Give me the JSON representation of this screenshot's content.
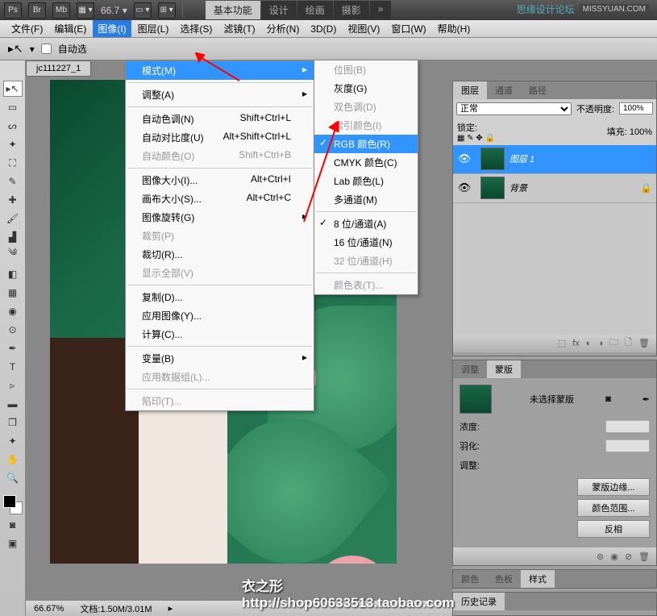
{
  "app": {
    "ps": "Ps",
    "br": "Br",
    "mb": "Mb",
    "zoom_pct": "66.7",
    "logo": "思缘设计论坛",
    "logo2": "MISSYUAN.COM"
  },
  "workspaces": {
    "basic": "基本功能",
    "design": "设计",
    "paint": "绘画",
    "photo": "摄影"
  },
  "menus": {
    "file": "文件(F)",
    "edit": "编辑(E)",
    "image": "图像(I)",
    "layer": "图层(L)",
    "select": "选择(S)",
    "filter": "滤镜(T)",
    "analysis": "分析(N)",
    "threed": "3D(D)",
    "view": "视图(V)",
    "window": "窗口(W)",
    "help": "帮助(H)"
  },
  "options": {
    "autosel": "自动选"
  },
  "doc": {
    "tab": "jc111227_1"
  },
  "dropdown": {
    "mode": "模式(M)",
    "adjust": "调整(A)",
    "autotone": "自动色调(N)",
    "autotone_sc": "Shift+Ctrl+L",
    "autocontrast": "自动对比度(U)",
    "autocontrast_sc": "Alt+Shift+Ctrl+L",
    "autocolor": "自动颜色(O)",
    "autocolor_sc": "Shift+Ctrl+B",
    "imagesize": "图像大小(I)...",
    "imagesize_sc": "Alt+Ctrl+I",
    "canvassize": "画布大小(S)...",
    "canvassize_sc": "Alt+Ctrl+C",
    "rotate": "图像旋转(G)",
    "crop": "裁剪(P)",
    "trim": "裁切(R)...",
    "reveal": "显示全部(V)",
    "dup": "复制(D)...",
    "apply": "应用图像(Y)...",
    "calc": "计算(C)...",
    "variables": "变量(B)",
    "datasets": "应用数据组(L)...",
    "trap": "陷印(T)..."
  },
  "submenu": {
    "bitmap": "位图(B)",
    "gray": "灰度(G)",
    "duotone": "双色调(D)",
    "indexed": "索引颜色(I)",
    "rgb": "RGB 颜色(R)",
    "cmyk": "CMYK 颜色(C)",
    "lab": "Lab 颜色(L)",
    "multi": "多通道(M)",
    "bit8": "8 位/通道(A)",
    "bit16": "16 位/通道(N)",
    "bit32": "32 位/通道(H)",
    "colortable": "颜色表(T)..."
  },
  "panels": {
    "layers_tab": "图层",
    "channels_tab": "通道",
    "paths_tab": "路径",
    "blend": "正常",
    "opacity_label": "不透明度:",
    "opacity_val": "100%",
    "lock_label": "锁定:",
    "fill_label": "填充:",
    "fill_val": "100%",
    "layer1": "图层 1",
    "bg_layer": "背景",
    "adjust_tab": "调整",
    "masks_tab": "蒙版",
    "mask_unsel": "未选择蒙版",
    "density": "浓度:",
    "feather": "羽化:",
    "refine": "调整:",
    "maskedge": "蒙版边缘...",
    "colorrange": "颜色范围...",
    "invert": "反相",
    "color_tab": "颜色",
    "swatch_tab": "色板",
    "style_tab": "样式",
    "history_tab": "历史记录"
  },
  "status": {
    "zoom": "66.67%",
    "docinfo": "文档:1.50M/3.01M"
  },
  "watermark": {
    "name": "衣之形",
    "url": "http://shop60633513.taobao.com"
  }
}
